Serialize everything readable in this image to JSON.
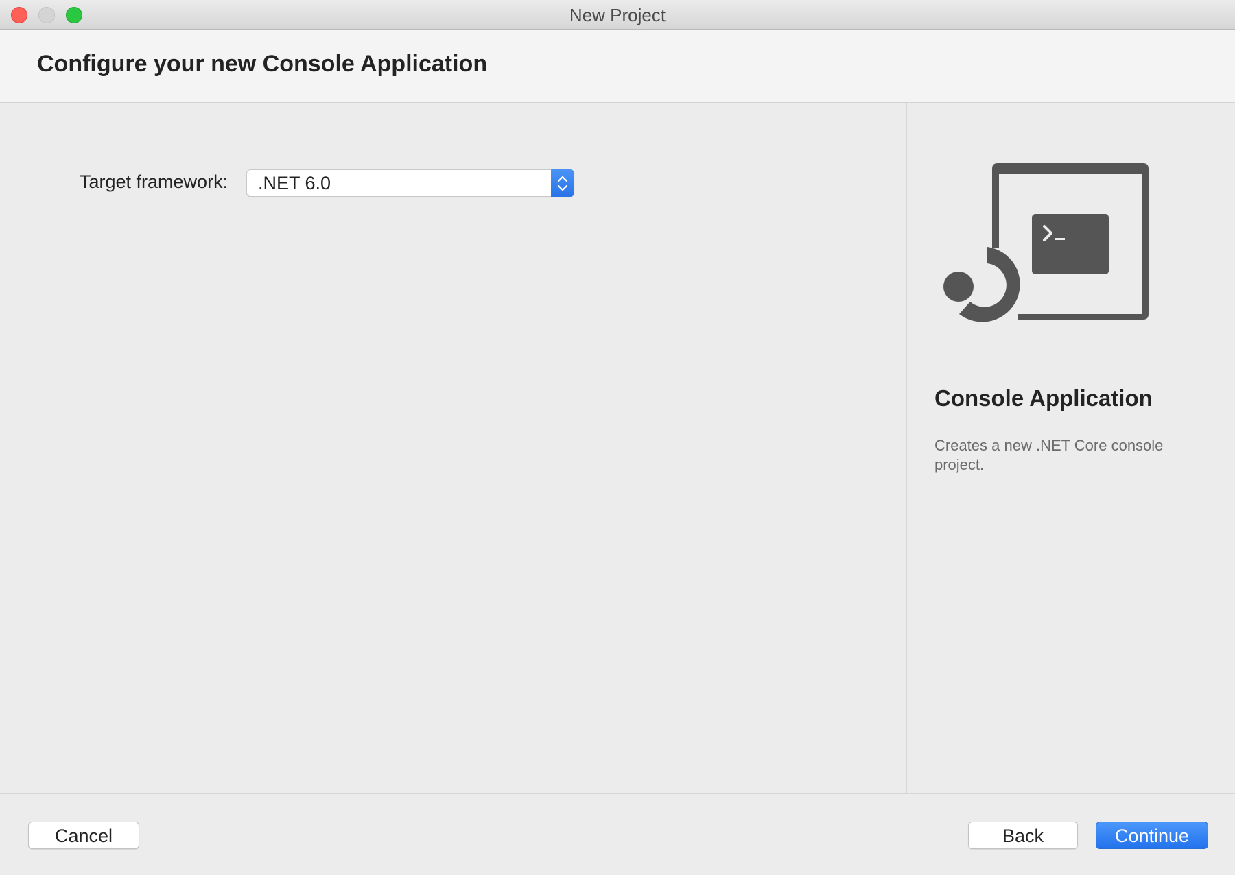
{
  "window": {
    "title": "New Project"
  },
  "header": {
    "title": "Configure your new Console Application"
  },
  "form": {
    "target_framework_label": "Target framework:",
    "target_framework_value": ".NET 6.0"
  },
  "template": {
    "icon": "console-app-icon",
    "name": "Console Application",
    "description": "Creates a new .NET Core console project."
  },
  "footer": {
    "cancel_label": "Cancel",
    "back_label": "Back",
    "continue_label": "Continue"
  },
  "colors": {
    "accent": "#2a73e8",
    "close": "#fe5f57",
    "zoom": "#29c840",
    "icon_gray": "#555555"
  }
}
